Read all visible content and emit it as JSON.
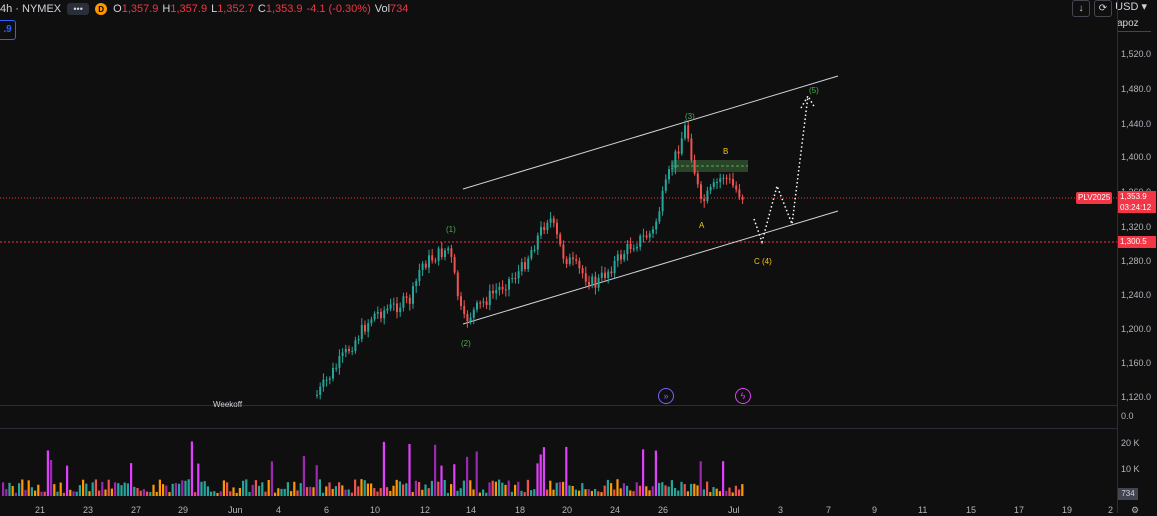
{
  "header": {
    "symbol": "4h · NYMEX",
    "dots": "•••",
    "badge": "D",
    "o_label": "O",
    "o": "1,357.9",
    "h_label": "H",
    "h": "1,357.9",
    "l_label": "L",
    "l": "1,352.7",
    "c_label": "C",
    "c": "1,353.9",
    "change": "-4.1 (-0.30%)",
    "vol_label": "Vol",
    "vol": "734"
  },
  "indicator_chip": ".9",
  "top_buttons": {
    "download_icon": "↓",
    "refresh_icon": "⟳",
    "maximize_icon": "▢"
  },
  "currency": "USD",
  "currency_chevron": "▾",
  "scale_name": "apoz",
  "y_axis": [
    "1,520.0",
    "1,480.0",
    "1,440.0",
    "1,400.0",
    "1,360.0",
    "1,320.0",
    "1,280.0",
    "1,240.0",
    "1,200.0",
    "1,160.0",
    "1,120.0"
  ],
  "x_axis": [
    "21",
    "23",
    "27",
    "29",
    "Jun",
    "4",
    "6",
    "10",
    "12",
    "14",
    "18",
    "20",
    "24",
    "26",
    "Jul",
    "3",
    "7",
    "9",
    "11",
    "15",
    "17",
    "19",
    "2"
  ],
  "price_tags": {
    "symbol_tag": "PLV2025",
    "last_price": "1,353.9",
    "countdown": "03:24:12",
    "level": "1,300.5"
  },
  "volume_axis": {
    "zero": "0.0",
    "20k": "20 K",
    "10k": "10 K",
    "current": "734"
  },
  "wave_labels": {
    "w1": "(1)",
    "w2": "(2)",
    "w3": "(3)",
    "w4": "C (4)",
    "w5": "(5)",
    "a": "A",
    "b": "B"
  },
  "partial_label": "Weekoff",
  "settings_icon": "⚙",
  "colors": {
    "up": "#26a69a",
    "down": "#ef5350",
    "wave": "#4caf50",
    "abc": "#f5c518",
    "channel": "#d1d4dc",
    "level": "#f23645",
    "vol_purple": "#9c27b0",
    "vol_orange": "#ff9800"
  }
}
